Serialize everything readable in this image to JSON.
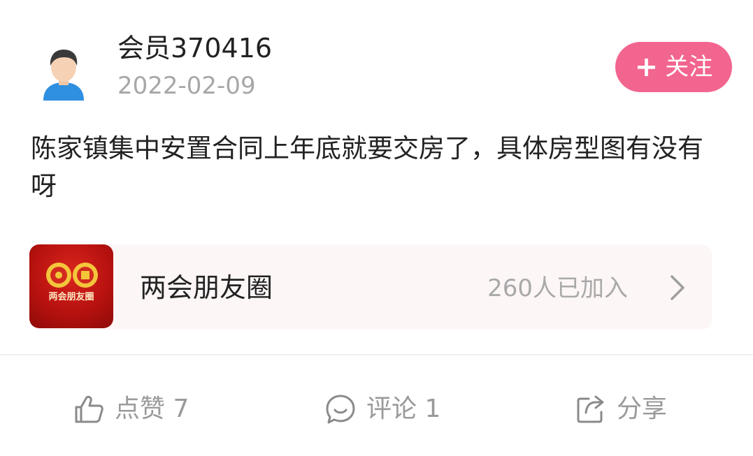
{
  "post": {
    "author": {
      "name": "会员370416",
      "date": "2022-02-09",
      "avatar_icon": "default-user-avatar"
    },
    "follow_button": {
      "plus": "+",
      "label": "关注",
      "color": "#f2658f"
    },
    "content": "陈家镇集中安置合同上年底就要交房了，具体房型图有没有呀",
    "circle": {
      "name": "两会朋友圈",
      "members": "260人已加入",
      "logo_text": "两会朋友圈",
      "logo_color": "#c4161c",
      "chevron_icon": "chevron-right-icon"
    },
    "actions": {
      "like": {
        "icon": "thumbs-up-icon",
        "label": "点赞 7"
      },
      "comment": {
        "icon": "comment-icon",
        "label": "评论 1"
      },
      "share": {
        "icon": "share-icon",
        "label": "分享"
      }
    }
  }
}
